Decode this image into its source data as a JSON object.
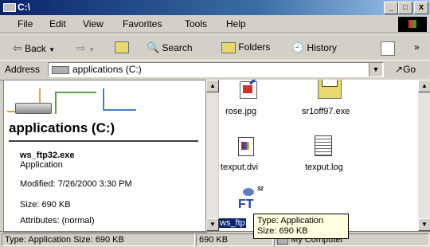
{
  "window": {
    "title": "C:\\",
    "minimize": "_",
    "maximize": "□",
    "close": "x"
  },
  "menu": {
    "file": "File",
    "edit": "Edit",
    "view": "View",
    "favorites": "Favorites",
    "tools": "Tools",
    "help": "Help"
  },
  "toolbar": {
    "back": "Back",
    "search": "Search",
    "folders": "Folders",
    "history": "History"
  },
  "address": {
    "label": "Address",
    "value": "applications (C:)",
    "go": "Go"
  },
  "left": {
    "drive_title": "applications (C:)",
    "file_name": "ws_ftp32.exe",
    "file_type": "Application",
    "modified": "Modified: 7/26/2000 3:30 PM",
    "size": "Size: 690 KB",
    "attributes": "Attributes: (normal)"
  },
  "files": [
    {
      "name": "rose.jpg"
    },
    {
      "name": "sr1off97.exe"
    },
    {
      "name": "texput.dvi"
    },
    {
      "name": "texput.log"
    },
    {
      "name": "ws_ftp32.exe",
      "visible_label": "ws_ftp"
    }
  ],
  "tooltip": {
    "line1": "Type: Application",
    "line2": "Size: 690 KB"
  },
  "status": {
    "left": "Type: Application Size: 690 KB",
    "middle": "690 KB",
    "right": "My Computer"
  }
}
